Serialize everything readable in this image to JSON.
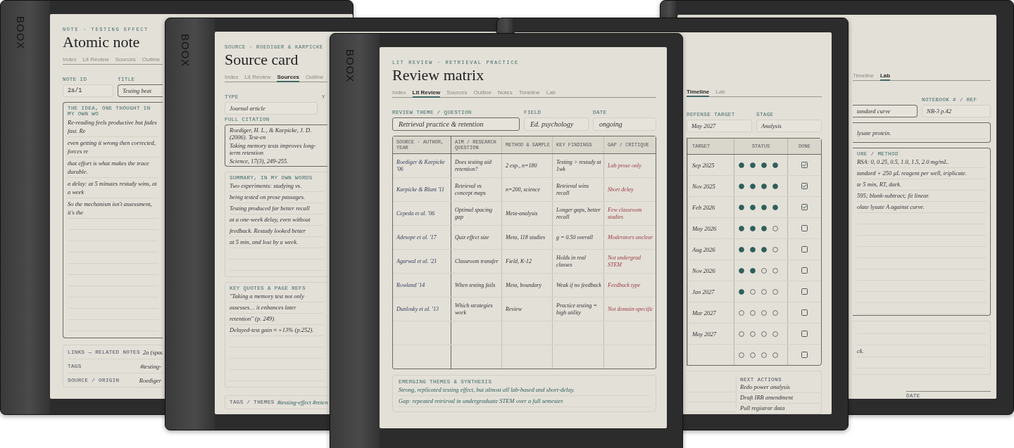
{
  "atomic_note": {
    "brand": "BOOX",
    "eyebrow": "NOTE · TESTING EFFECT",
    "title": "Atomic note",
    "tabs": [
      {
        "label": "Index",
        "selected": false
      },
      {
        "label": "Lit Review",
        "selected": false
      },
      {
        "label": "Sources",
        "selected": false
      },
      {
        "label": "Outline",
        "selected": false
      }
    ],
    "fields": [
      {
        "label": "NOTE ID",
        "value": "2a/1"
      },
      {
        "label": "TITLE",
        "value": "Testing beat"
      }
    ],
    "idea": {
      "label": "THE IDEA, ONE THOUGHT IN MY OWN WO",
      "lines": [
        "Re-reading feels productive but fades fast. Re",
        "even getting it wrong then corrected, forces re",
        "that effort is what makes the trace durable.",
        "a delay: at 5 minutes restudy wins, at a week",
        "So the mechanism isn't assessment, it's the"
      ]
    },
    "links": [
      {
        "label": "LINKS → RELATED NOTES",
        "value": "2a (spac"
      },
      {
        "label": "TAGS",
        "value": "#testing-"
      },
      {
        "label": "SOURCE / ORIGIN",
        "value": "Roediger"
      }
    ]
  },
  "source_card": {
    "brand": "BOOX",
    "eyebrow": "SOURCE · ROEDIGER & KARPICKE",
    "title": "Source card",
    "tabs": [
      {
        "label": "Index",
        "selected": false
      },
      {
        "label": "Lit Review",
        "selected": false
      },
      {
        "label": "Sources",
        "selected": true
      },
      {
        "label": "Outline",
        "selected": false
      }
    ],
    "type": {
      "label": "TYPE",
      "value": "Journal article"
    },
    "year_label": "Y",
    "citation": {
      "label": "FULL CITATION",
      "lines": [
        "Roediger, H. L., & Karpicke, J. D. (2006). Test-en",
        "Taking memory tests improves long-term retention",
        "Science, 17(3), 249-255."
      ]
    },
    "summary": {
      "label": "SUMMARY, IN MY OWN WORDS",
      "lines": [
        "Two experiments: studying vs.",
        "being tested on prose passages.",
        "Testing produced far better recall",
        "at a one-week delay, even without",
        "feedback. Restudy looked better",
        "at 5 min, and lost by a week."
      ]
    },
    "quotes": {
      "label": "KEY QUOTES & PAGE REFS",
      "lines": [
        "\"Taking a memory test not only",
        "assesses… it enhances later",
        "retention\" (p. 249).",
        "Delayed-test gain ≈ +13% (p.252)."
      ]
    },
    "tags": {
      "label": "TAGS / THEMES",
      "value": "#testing-effect #reten"
    }
  },
  "review_matrix": {
    "brand": "BOOX",
    "eyebrow": "LIT REVIEW · RETRIEVAL PRACTICE",
    "title": "Review matrix",
    "tabs": [
      {
        "label": "Index",
        "selected": false
      },
      {
        "label": "Lit Review",
        "selected": true
      },
      {
        "label": "Sources",
        "selected": false
      },
      {
        "label": "Outline",
        "selected": false
      },
      {
        "label": "Notes",
        "selected": false
      },
      {
        "label": "Timeline",
        "selected": false
      },
      {
        "label": "Lab",
        "selected": false
      }
    ],
    "fields": [
      {
        "label": "REVIEW THEME / QUESTION",
        "value": "Retrieval practice & retention"
      },
      {
        "label": "FIELD",
        "value": "Ed. psychology"
      },
      {
        "label": "DATE",
        "value": "ongoing"
      }
    ],
    "table": {
      "columns": [
        "SOURCE · AUTHOR, YEAR",
        "AIM / RESEARCH QUESTION",
        "METHOD & SAMPLE",
        "KEY FINDINGS",
        "GAP / CRITIQUE"
      ],
      "rows": [
        [
          "Roediger & Karpicke '06",
          "Does testing aid retention?",
          "2 exp., n=180",
          "Testing > restudy at 1wk",
          "Lab prose only"
        ],
        [
          "Karpicke & Blunt '11",
          "Retrieval vs concept maps",
          "n=200, science",
          "Retrieval wins recall",
          "Short delay"
        ],
        [
          "Cepeda et al. '06",
          "Optimal spacing gap",
          "Meta-analysis",
          "Longer gaps, better recall",
          "Few classroom studies"
        ],
        [
          "Adesope et al. '17",
          "Quiz effect size",
          "Meta, 118 studies",
          "g = 0.50 overall",
          "Moderators unclear"
        ],
        [
          "Agarwal et al. '21",
          "Classroom transfer",
          "Field, K-12",
          "Holds in real classes",
          "Not undergrad STEM"
        ],
        [
          "Rowland '14",
          "When testing fails",
          "Meta, boundary",
          "Weak if no feedback",
          "Feedback type"
        ],
        [
          "Dunlosky et al. '13",
          "Which strategies work",
          "Review",
          "Practice testing = high utility",
          "Not domain-specific"
        ]
      ]
    },
    "synthesis": {
      "label": "EMERGING THEMES & SYNTHESIS",
      "lines": [
        "Strong, replicated testing effect, but almost all lab-based and short-delay.",
        "Gap: repeated retrieval in undergraduate STEM over a full semester."
      ]
    }
  },
  "timeline_page": {
    "tabs": [
      {
        "label": "Timeline",
        "selected": true
      },
      {
        "label": "Lab",
        "selected": false
      }
    ],
    "fields": [
      {
        "label": "DEFENSE TARGET",
        "value": "May 2027"
      },
      {
        "label": "STAGE",
        "value": "Analysis"
      }
    ],
    "columns": [
      "TARGET",
      "STATUS",
      "DONE"
    ],
    "rows": [
      {
        "target": "Sep 2025",
        "stars": 4,
        "checked": true
      },
      {
        "target": "Nov 2025",
        "stars": 4,
        "checked": true
      },
      {
        "target": "Feb 2026",
        "stars": 4,
        "checked": true
      },
      {
        "target": "May 2026",
        "stars": 3,
        "checked": false
      },
      {
        "target": "Aug 2026",
        "stars": 3,
        "checked": false
      },
      {
        "target": "Nov 2026",
        "stars": 2,
        "checked": false
      },
      {
        "target": "Jan 2027",
        "stars": 1,
        "checked": false
      },
      {
        "target": "Mar 2027",
        "stars": 0,
        "checked": false
      },
      {
        "target": "May 2027",
        "stars": 0,
        "checked": false
      },
      {
        "stars": 0,
        "checked": false
      }
    ],
    "next_actions": {
      "label": "NEXT ACTIONS",
      "items": [
        "Redo power analysis",
        "Draft IRB amendment",
        "Pull registrar data"
      ]
    }
  },
  "lab_page": {
    "tabs": [
      {
        "label": "Timeline",
        "selected": false
      },
      {
        "label": "Lab",
        "selected": true
      }
    ],
    "fields": [
      {
        "value": "tandard curve"
      },
      {
        "label": "NOTEBOOK # / REF",
        "value": "NB-3 p.42"
      }
    ],
    "aim_line": "lysate protein.",
    "procedure": {
      "label": "URE / METHOD",
      "lines": [
        "BSA: 0, 0.25, 0.5, 1.0, 1.5, 2.0 mg/mL.",
        "tandard + 250 µL reagent per well, triplicate.",
        "te 5 min, RT, dark.",
        "595; blank-subtract; fit linear.",
        "olate lysate A against curve."
      ]
    },
    "results_line": "ck.",
    "sign_label": "DATE"
  }
}
